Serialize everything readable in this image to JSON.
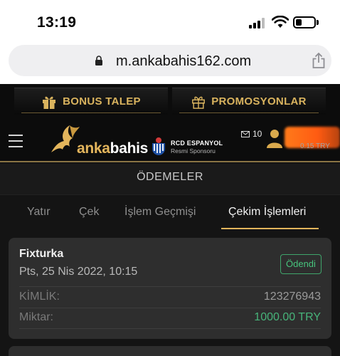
{
  "status_bar": {
    "time": "13:19"
  },
  "browser": {
    "url": "m.ankabahis162.com"
  },
  "site": {
    "bonus_button": "BONUS TALEP",
    "promo_button": "PROMOSYONLAR",
    "logo_part1": "anka",
    "logo_part2": "bahis",
    "sponsor_name": "RCD ESPANYOL",
    "sponsor_sub": "Resmi Sponsoru",
    "message_count": "10",
    "balance": "0.15 TRY"
  },
  "section_title": "ÖDEMELER",
  "tabs": [
    {
      "label": "Yatır",
      "active": false
    },
    {
      "label": "Çek",
      "active": false
    },
    {
      "label": "İşlem Geçmişi",
      "active": false
    },
    {
      "label": "Çekim İşlemleri",
      "active": true
    }
  ],
  "transaction": {
    "title": "Fixturka",
    "date": "Pts, 25 Nis 2022, 10:15",
    "status": "Ödendi",
    "id_label": "KİMLİK:",
    "id_value": "123276943",
    "amount_label": "Miktar:",
    "amount_value": "1000.00 TRY"
  },
  "colors": {
    "accent_gold": "#e3b55c",
    "paid_green": "#47c47d",
    "card_bg": "#2e2e2e"
  },
  "battery_level": 0.35
}
